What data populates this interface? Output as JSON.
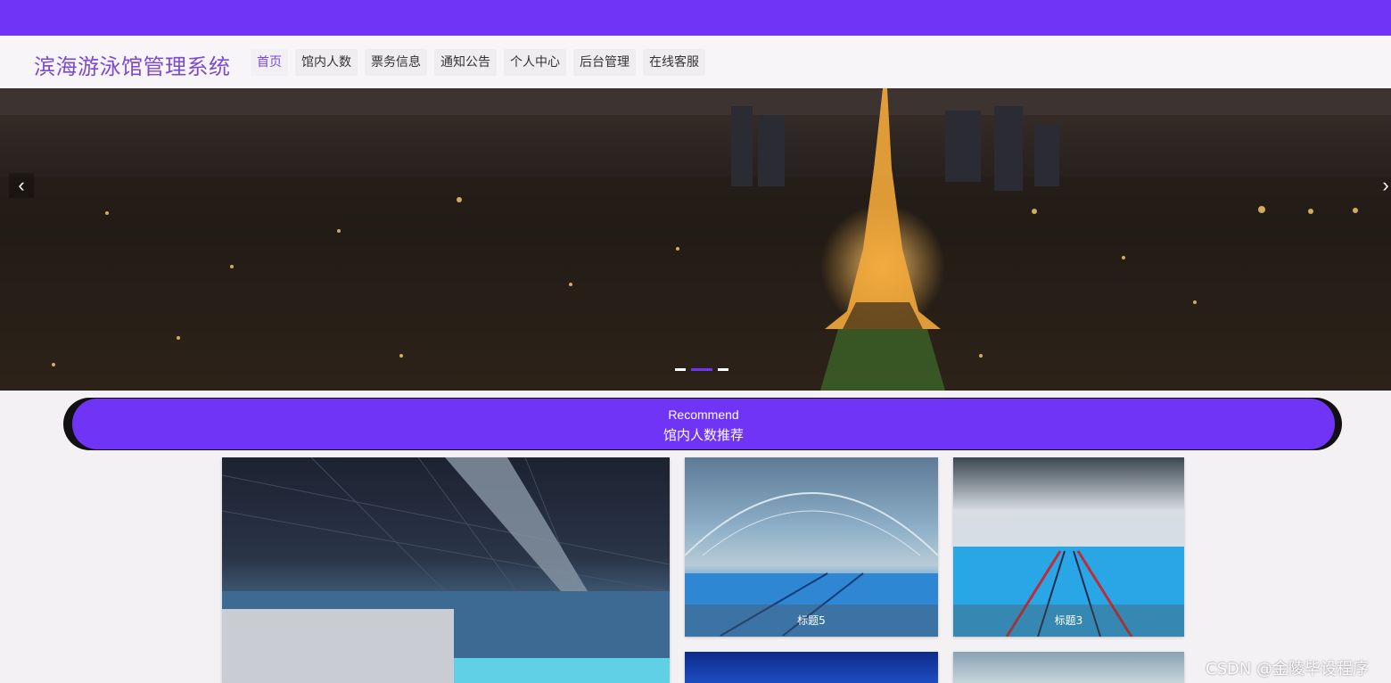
{
  "brand": {
    "title": "滨海游泳馆管理系统",
    "color": "#7b4bd1"
  },
  "theme": {
    "accent": "#7034f7",
    "background": "#f3f1f4"
  },
  "nav": {
    "items": [
      {
        "label": "首页",
        "active": true
      },
      {
        "label": "馆内人数",
        "active": false
      },
      {
        "label": "票务信息",
        "active": false
      },
      {
        "label": "通知公告",
        "active": false
      },
      {
        "label": "个人中心",
        "active": false
      },
      {
        "label": "后台管理",
        "active": false
      },
      {
        "label": "在线客服",
        "active": false
      }
    ]
  },
  "carousel": {
    "prev_icon": "chevron-left-icon",
    "next_icon": "chevron-right-icon",
    "prev_glyph": "‹",
    "next_glyph": "›",
    "slide_count": 3,
    "active_index": 1
  },
  "recommend": {
    "title_en": "Recommend",
    "title_cn": "馆内人数推荐"
  },
  "cards": [
    {
      "caption": ""
    },
    {
      "caption": "标题5"
    },
    {
      "caption": "标题3"
    },
    {
      "caption": ""
    },
    {
      "caption": ""
    }
  ],
  "watermark": "CSDN @金陵毕设程序"
}
